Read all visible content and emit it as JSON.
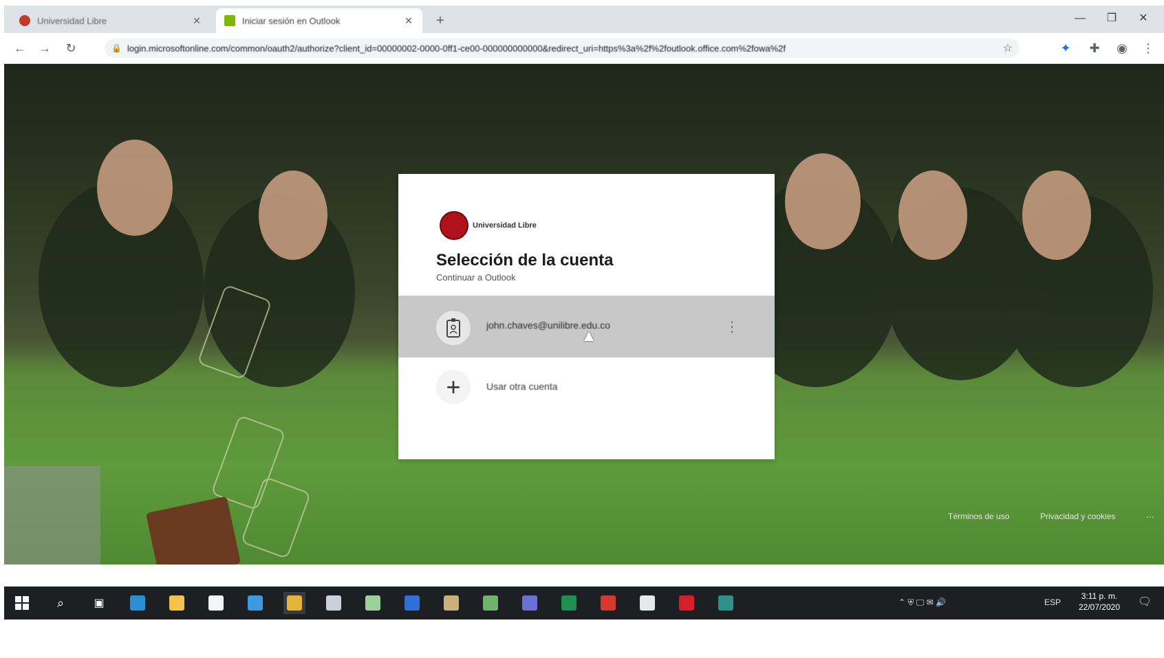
{
  "browser": {
    "tabs": [
      {
        "title": "Universidad Libre",
        "favicon_color": "#c0392b",
        "active": false
      },
      {
        "title": "Iniciar sesión en Outlook",
        "favicon_color": "#7fb800",
        "active": true
      }
    ],
    "new_tab_label": "+",
    "url": "login.microsoftonline.com/common/oauth2/authorize?client_id=00000002-0000-0ff1-ce00-000000000000&redirect_uri=https%3a%2f%2foutlook.office.com%2fowa%2f"
  },
  "signin": {
    "org_name": "Universidad Libre",
    "heading": "Selección de la cuenta",
    "subheading": "Continuar a Outlook",
    "account": {
      "email": "john.chaves@unilibre.edu.co"
    },
    "other_account_label": "Usar otra cuenta"
  },
  "footer": {
    "terms": "Términos de uso",
    "privacy": "Privacidad y cookies",
    "more": "..."
  },
  "taskbar": {
    "lang": "ESP",
    "time": "3:11 p. m.",
    "date": "22/07/2020",
    "apps": [
      {
        "name": "edge",
        "color": "#2b8fd6"
      },
      {
        "name": "file-explorer",
        "color": "#f2c24a"
      },
      {
        "name": "store",
        "color": "#f5f5f5"
      },
      {
        "name": "mail",
        "color": "#3b9ae0"
      },
      {
        "name": "chrome",
        "color": "#e3b33a"
      },
      {
        "name": "app-6",
        "color": "#c9d2da"
      },
      {
        "name": "app-7",
        "color": "#9bd09b"
      },
      {
        "name": "app-8",
        "color": "#2f6fd6"
      },
      {
        "name": "app-9",
        "color": "#c9b07a"
      },
      {
        "name": "app-10",
        "color": "#73b26e"
      },
      {
        "name": "teams",
        "color": "#6b6fd6"
      },
      {
        "name": "excel",
        "color": "#1e8f4e"
      },
      {
        "name": "app-13",
        "color": "#d63a2f"
      },
      {
        "name": "app-14",
        "color": "#e8e8e8"
      },
      {
        "name": "app-15",
        "color": "#d61f2a"
      },
      {
        "name": "app-16",
        "color": "#2f8f8a"
      }
    ]
  }
}
